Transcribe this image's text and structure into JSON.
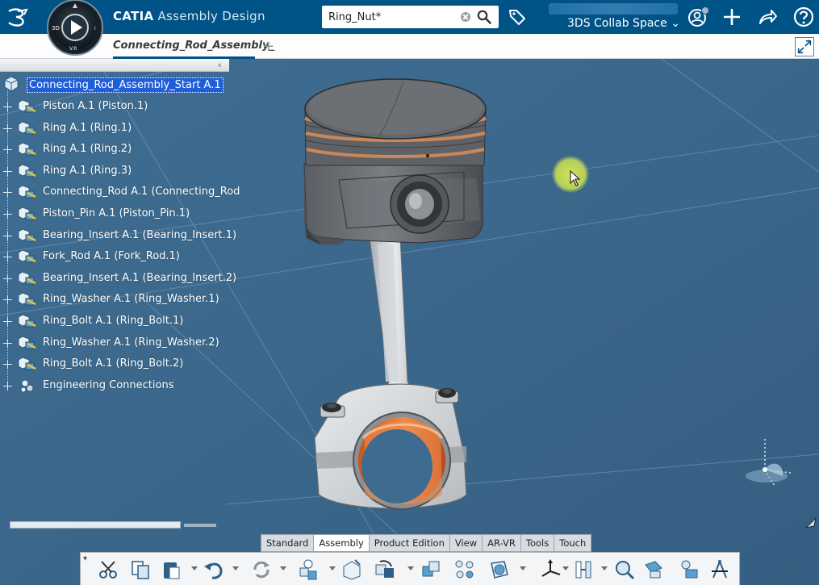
{
  "header": {
    "brand": "CATIA",
    "app_name": "Assembly Design",
    "search_value": "Ring_Nut*",
    "collab_space": "3DS Collab Space",
    "compass_labels": {
      "top": "3D",
      "bottom": "V.R"
    }
  },
  "tabs": {
    "active_label": "Connecting_Rod_Assembly_"
  },
  "tree": {
    "root": "Connecting_Rod_Assembly_Start A.1",
    "items": [
      {
        "label": "Piston A.1 (Piston.1)"
      },
      {
        "label": "Ring A.1 (Ring.1)"
      },
      {
        "label": "Ring A.1 (Ring.2)"
      },
      {
        "label": "Ring A.1 (Ring.3)"
      },
      {
        "label": "Connecting_Rod A.1 (Connecting_Rod"
      },
      {
        "label": "Piston_Pin A.1 (Piston_Pin.1)"
      },
      {
        "label": "Bearing_Insert A.1 (Bearing_Insert.1)"
      },
      {
        "label": "Fork_Rod A.1 (Fork_Rod.1)"
      },
      {
        "label": "Bearing_Insert A.1 (Bearing_Insert.2)"
      },
      {
        "label": "Ring_Washer A.1 (Ring_Washer.1)"
      },
      {
        "label": "Ring_Bolt A.1 (Ring_Bolt.1)"
      },
      {
        "label": "Ring_Washer A.1 (Ring_Washer.2)"
      },
      {
        "label": "Ring_Bolt A.1 (Ring_Bolt.2)"
      },
      {
        "label": "Engineering Connections"
      }
    ]
  },
  "action_bar": {
    "tabs": [
      {
        "label": "Standard"
      },
      {
        "label": "Assembly"
      },
      {
        "label": "Product Edition"
      },
      {
        "label": "View"
      },
      {
        "label": "AR-VR"
      },
      {
        "label": "Tools"
      },
      {
        "label": "Touch"
      }
    ],
    "active_tab": "Assembly",
    "tools": [
      "cut-icon",
      "copy-icon",
      "paste-icon",
      "undo-icon",
      "update-icon",
      "new-component-icon",
      "insert-existing-icon",
      "replace-icon",
      "explode-icon",
      "structure-icon",
      "section-icon",
      "compass-tool-icon",
      "constraints-icon",
      "measure-icon",
      "clash-icon",
      "analysis-icon",
      "robot-icon"
    ]
  },
  "colors": {
    "topbar": "#005386",
    "viewport": "#3d6b8f",
    "selection": "#1f5ed8",
    "bearing": "#e06a28",
    "ring": "#c8885a"
  }
}
